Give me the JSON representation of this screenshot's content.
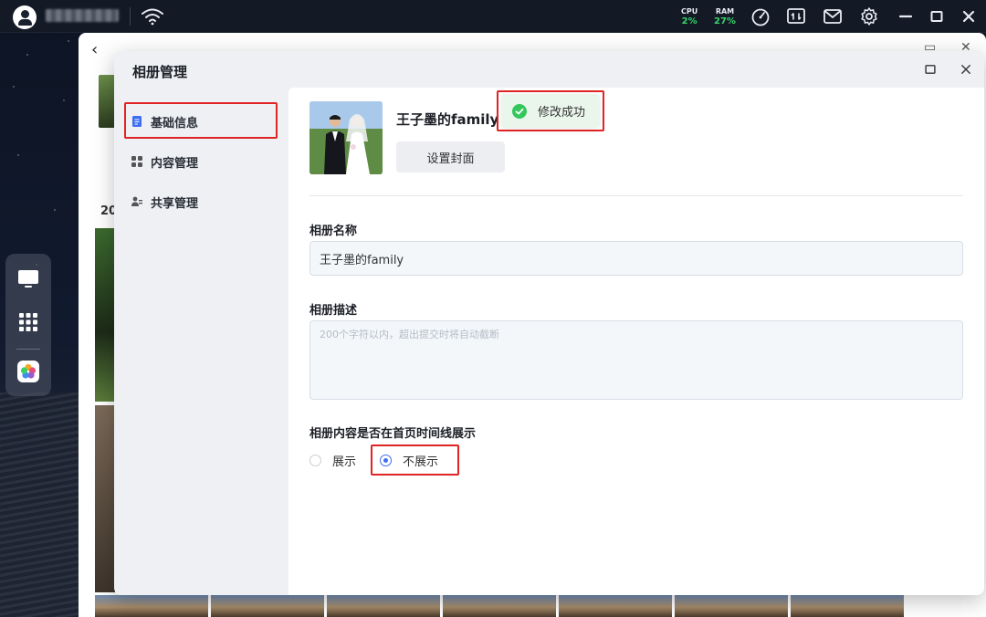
{
  "topbar": {
    "cpu_label": "CPU",
    "cpu_value": "2%",
    "ram_label": "RAM",
    "ram_value": "27%",
    "icons": [
      "wifi-icon",
      "speedometer-icon",
      "monitor-chart-icon",
      "mail-icon",
      "gear-icon",
      "minimize-icon",
      "maximize-icon",
      "close-icon"
    ]
  },
  "background_window": {
    "year_label": "20"
  },
  "dialog": {
    "title": "相册管理",
    "nav": [
      {
        "label": "基础信息",
        "icon": "document-icon",
        "active": true
      },
      {
        "label": "内容管理",
        "icon": "grid-icon",
        "active": false
      },
      {
        "label": "共享管理",
        "icon": "share-icon",
        "active": false
      }
    ]
  },
  "content": {
    "album_name": "王子墨的family",
    "set_cover_label": "设置封面",
    "toast_text": "修改成功",
    "name_label": "相册名称",
    "name_value": "王子墨的family",
    "desc_label": "相册描述",
    "desc_placeholder": "200个字符以内，超出提交时将自动截断",
    "timeline_label": "相册内容是否在首页时间线展示",
    "timeline_options": [
      {
        "label": "展示",
        "checked": false
      },
      {
        "label": "不展示",
        "checked": true
      }
    ]
  },
  "colors": {
    "accent": "#3d6df2",
    "success": "#34c759",
    "stat_green": "#37d46b",
    "highlight_red": "#e02424"
  }
}
